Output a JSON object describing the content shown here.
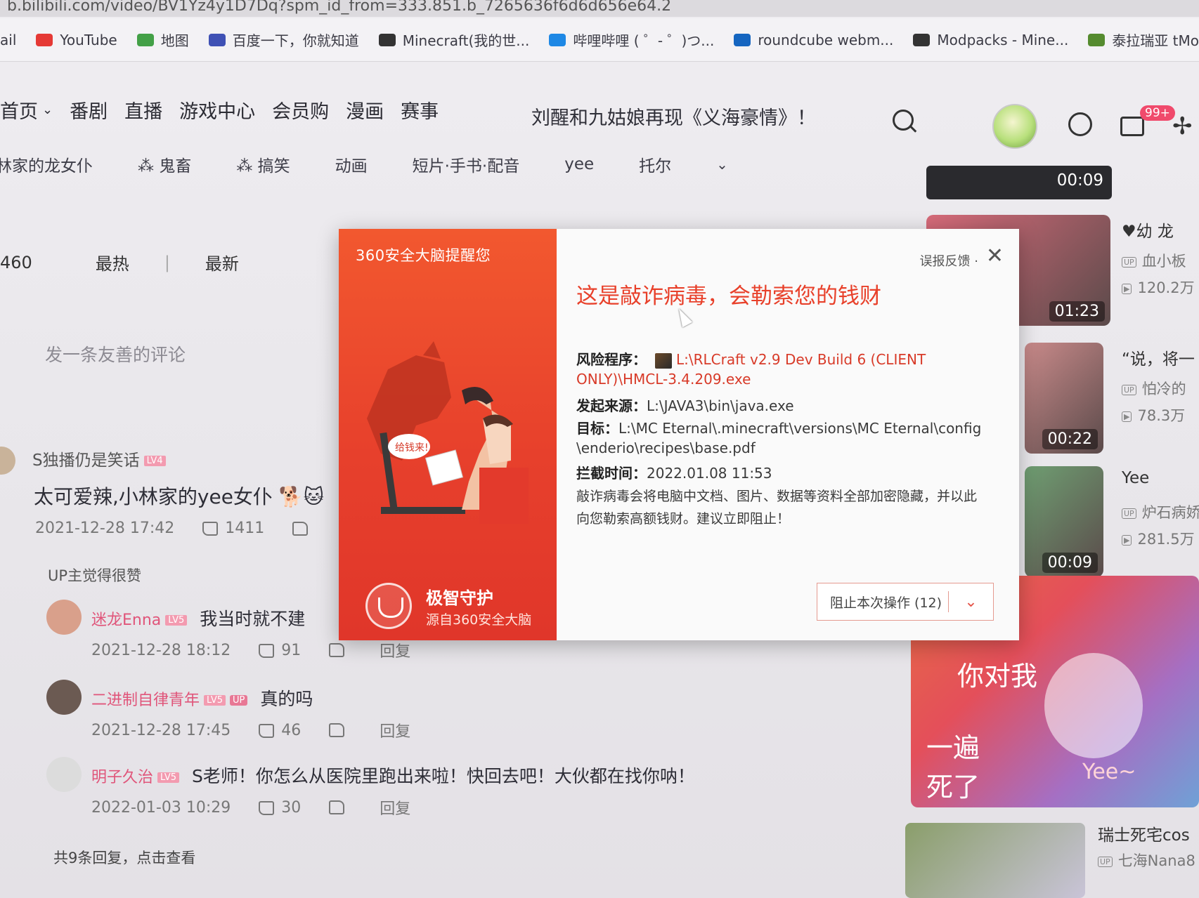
{
  "browser": {
    "url_fragment": "b.bilibili.com/video/BV1Yz4y1D7Dq?spm_id_from=333.851.b_7265636f6d6d656e64.2",
    "bookmarks": [
      {
        "label": "ail",
        "icon": "mail-icon",
        "color": "#888888"
      },
      {
        "label": "YouTube",
        "icon": "youtube-icon",
        "color": "#e53935"
      },
      {
        "label": "地图",
        "icon": "map-icon",
        "color": "#43a047"
      },
      {
        "label": "百度一下，你就知道",
        "icon": "baidu-icon",
        "color": "#3f51b5"
      },
      {
        "label": "Minecraft(我的世...",
        "icon": "minecraft-icon",
        "color": "#333333"
      },
      {
        "label": "哔哩哔哩 ( ゜- ゜)つ...",
        "icon": "bilibili-icon",
        "color": "#1e88e5"
      },
      {
        "label": "roundcube webm...",
        "icon": "roundcube-icon",
        "color": "#1565c0"
      },
      {
        "label": "Modpacks - Mine...",
        "icon": "curseforge-icon",
        "color": "#333333"
      },
      {
        "label": "泰拉瑞亚 tModLoa",
        "icon": "tmodloader-icon",
        "color": "#558b2f"
      }
    ]
  },
  "topnav": {
    "items": [
      "首页",
      "番剧",
      "直播",
      "游戏中心",
      "会员购",
      "漫画",
      "赛事"
    ],
    "headline": "刘醒和九姑娘再现《义海豪情》！",
    "badge": "99+"
  },
  "categories": [
    "林家的龙女仆",
    "鬼畜",
    "搞笑",
    "动画",
    "短片·手书·配音",
    "yee",
    "托尔"
  ],
  "comments_section": {
    "count_fragment": "460",
    "sort_hot": "最热",
    "sort_new": "最新",
    "input_placeholder": "发一条友善的评论",
    "main_comment": {
      "user": "S独播仍是笑话",
      "text": "太可爱辣,小林家的yee女仆",
      "time": "2021-12-28 17:42",
      "likes": "1411",
      "up_liked": "UP主觉得很赞"
    },
    "replies": [
      {
        "user": "迷龙Enna",
        "text": "我当时就不建",
        "time": "2021-12-28 18:12",
        "likes": "91",
        "reply": "回复",
        "up": false
      },
      {
        "user": "二进制自律青年",
        "text": "真的吗",
        "time": "2021-12-28 17:45",
        "likes": "46",
        "reply": "回复",
        "up": true
      },
      {
        "user": "明子久治",
        "text": "S老师！你怎么从医院里跑出来啦！快回去吧！大伙都在找你呐！",
        "time": "2022-01-03 10:29",
        "likes": "30",
        "reply": "回复",
        "up": false
      }
    ],
    "more_replies": "共9条回复，点击查看"
  },
  "rail": {
    "top_time": "00:09",
    "cards": [
      {
        "time": "01:23",
        "title": "♥幼 龙",
        "up": "血小板",
        "views": "120.2万",
        "color": "#d86b7a"
      },
      {
        "time": "00:22",
        "title": "“说，将一",
        "up": "怕冷的",
        "views": "78.3万",
        "color": "#c98a8a"
      },
      {
        "time": "00:09",
        "title": "Yee",
        "up": "炉石病娇",
        "views": "281.5万",
        "color": "#6f9e72"
      }
    ],
    "ad_lines": [
      "你对我",
      "一遍",
      "死了",
      "Yee~"
    ],
    "last_title": "瑞士死宅cos",
    "last_up": "七海Nana8"
  },
  "popup": {
    "brand": "360安全大脑提醒您",
    "report": "误报反馈",
    "title": "这是敲诈病毒，会勒索您的钱财",
    "risk_label": "风险程序：",
    "risk_path_1": "L:\\RLCraft v2.9 Dev Build 6 (CLIENT",
    "risk_path_2": "ONLY)\\HMCL-3.4.209.exe",
    "source_label": "发起来源：",
    "source_value": "L:\\JAVA3\\bin\\java.exe",
    "target_label": "目标：",
    "target_value_1": "L:\\MC Eternal\\.minecraft\\versions\\MC Eternal\\config",
    "target_value_2": "\\enderio\\recipes\\base.pdf",
    "time_label": "拦截时间：",
    "time_value": "2022.01.08 11:53",
    "desc_1": "敲诈病毒会将电脑中文档、图片、数据等资料全部加密隐藏，并以此",
    "desc_2": "向您勒索高额钱财。建议立即阻止！",
    "block_button": "阻止本次操作 (12)",
    "guard_title": "极智守护",
    "guard_sub": "源自360安全大脑",
    "illus_text": "给钱来!"
  }
}
